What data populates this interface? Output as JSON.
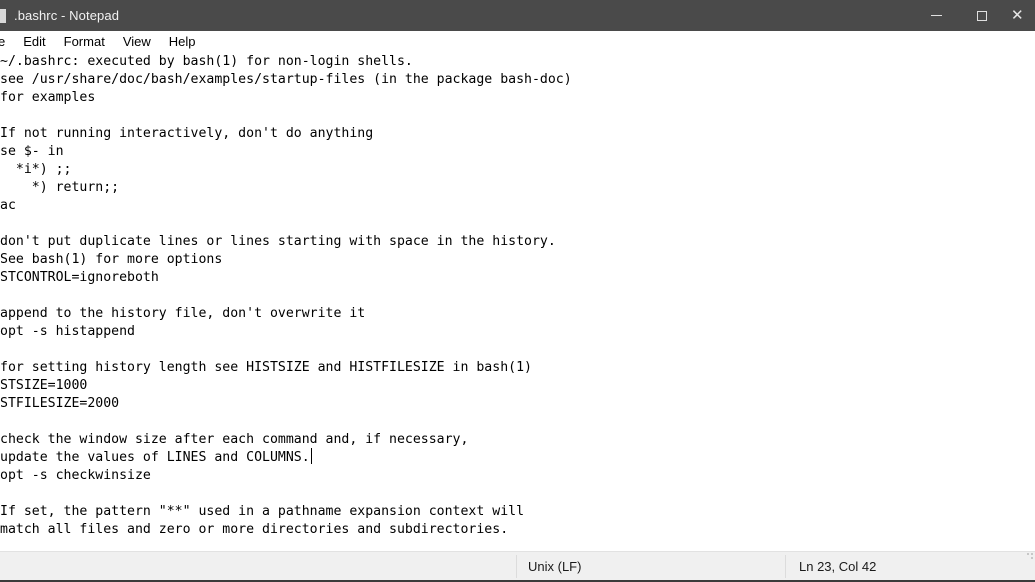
{
  "window": {
    "title": ".bashrc - Notepad",
    "app_icon": "notepad-icon",
    "controls": {
      "minimize_label": "—",
      "maximize_label": "□",
      "close_label": "✕"
    },
    "colors": {
      "titlebar_bg": "#4a4a4a",
      "titlebar_text": "#f2f2f2",
      "editor_bg": "#ffffff",
      "editor_text": "#000000",
      "statusbar_bg": "#f0f0f0"
    }
  },
  "menubar": {
    "items": [
      {
        "label": "e",
        "name": "menu-file",
        "clipped": true
      },
      {
        "label": "Edit",
        "name": "menu-edit",
        "clipped": false
      },
      {
        "label": "Format",
        "name": "menu-format",
        "clipped": false
      },
      {
        "label": "View",
        "name": "menu-view",
        "clipped": false
      },
      {
        "label": "Help",
        "name": "menu-help",
        "clipped": false
      }
    ]
  },
  "editor": {
    "horizontally_scrolled": true,
    "caret_visible": true,
    "lines": [
      "~/.bashrc: executed by bash(1) for non-login shells.",
      "see /usr/share/doc/bash/examples/startup-files (in the package bash-doc)",
      "for examples",
      "",
      "If not running interactively, don't do anything",
      "se $- in",
      "  *i*) ;;",
      "    *) return;;",
      "ac",
      "",
      "don't put duplicate lines or lines starting with space in the history.",
      "See bash(1) for more options",
      "STCONTROL=ignoreboth",
      "",
      "append to the history file, don't overwrite it",
      "opt -s histappend",
      "",
      "for setting history length see HISTSIZE and HISTFILESIZE in bash(1)",
      "STSIZE=1000",
      "STFILESIZE=2000",
      "",
      "check the window size after each command and, if necessary,",
      "update the values of LINES and COLUMNS.",
      "opt -s checkwinsize",
      "",
      "If set, the pattern \"**\" used in a pathname expansion context will",
      "match all files and zero or more directories and subdirectories."
    ]
  },
  "statusbar": {
    "line_ending": "Unix (LF)",
    "cursor_position": "Ln 23, Col 42"
  }
}
